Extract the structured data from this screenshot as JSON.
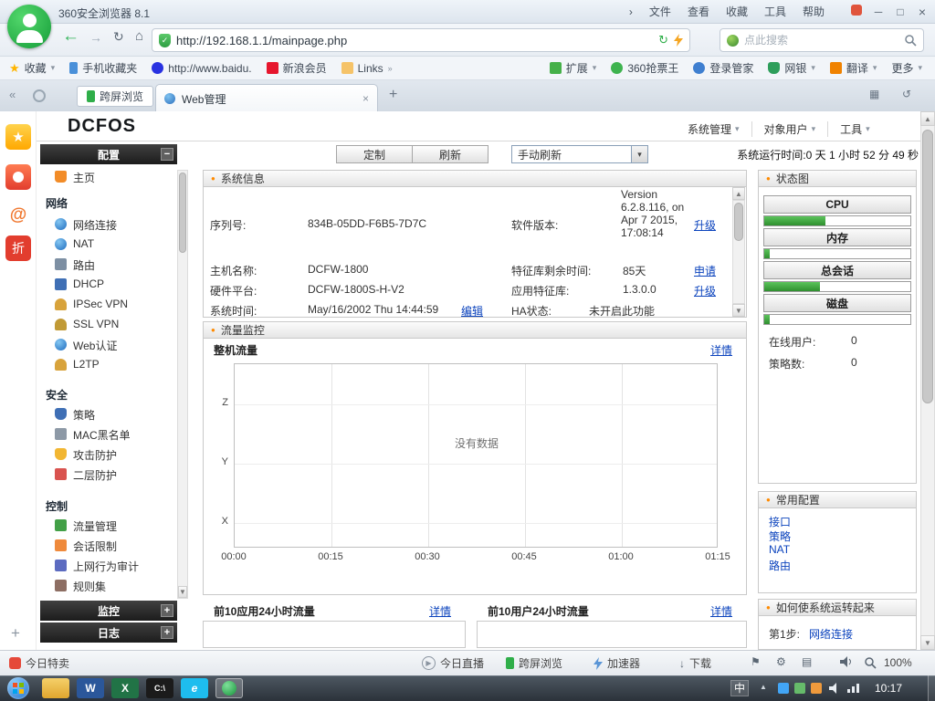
{
  "icons": {
    "back": "←",
    "forward": "→",
    "reload": "↻",
    "home": "⌂",
    "dropdown": "▾",
    "chevron_right": "›",
    "chevron_left": "«",
    "minimize": "─",
    "maximize": "□",
    "close": "×",
    "tab_close": "×",
    "new_tab": "+",
    "plus": "+",
    "collapse": "−",
    "expand": "+",
    "bullet": "●",
    "star": "★",
    "up": "▲",
    "down": "▼",
    "play": "▶",
    "download_arrow": "↓",
    "links_more": "»",
    "restore": "▦",
    "undo": "↺",
    "flag": "⚑",
    "gear": "⚙",
    "page": "▤",
    "check": "✓",
    "word_glyph": "W",
    "excel_glyph": "X",
    "cmd_glyph": "C:\\",
    "ie_glyph": "e"
  },
  "titlebar": {
    "app_title": "360安全浏览器 8.1",
    "menus": [
      "文件",
      "查看",
      "收藏",
      "工具",
      "帮助"
    ]
  },
  "addressbar": {
    "url": "http://192.168.1.1/mainpage.php",
    "search_placeholder": "点此搜索"
  },
  "bookmarks_bar": {
    "favorites": "收藏",
    "items": [
      "手机收藏夹",
      "http://www.baidu.",
      "新浪会员",
      "Links"
    ],
    "tools": [
      "扩展",
      "360抢票王",
      "登录管家",
      "网银",
      "翻译",
      "更多"
    ]
  },
  "tab_bar": {
    "cross_screen": "跨屏浏览",
    "active_tab": "Web管理"
  },
  "side_strip": {
    "at": "@",
    "discount": "折"
  },
  "page": {
    "logo": "DCFOS",
    "top_menus": [
      "系统管理",
      "对象用户",
      "工具"
    ],
    "toolbar": {
      "customize": "定制",
      "refresh": "刷新",
      "refresh_mode": "手动刷新",
      "uptime": "系统运行时间:0 天 1 小时 52 分 49 秒"
    },
    "nav": {
      "config": "配置",
      "home": "主页",
      "monitor": "监控",
      "log": "日志",
      "groups": [
        {
          "label": "网络",
          "items": [
            "网络连接",
            "NAT",
            "路由",
            "DHCP",
            "IPSec VPN",
            "SSL VPN",
            "Web认证",
            "L2TP"
          ]
        },
        {
          "label": "安全",
          "items": [
            "策略",
            "MAC黑名单",
            "攻击防护",
            "二层防护"
          ]
        },
        {
          "label": "控制",
          "items": [
            "流量管理",
            "会话限制",
            "上网行为审计",
            "规则集"
          ]
        }
      ]
    },
    "system_info": {
      "title": "系统信息",
      "serial_label": "序列号:",
      "serial": "834B-05DD-F6B5-7D7C",
      "version_label": "软件版本:",
      "version": "Version 6.2.8.116, on Apr 7 2015, 17:08:14",
      "version_link": "升级",
      "hostname_label": "主机名称:",
      "hostname": "DCFW-1800",
      "signature_label": "特征库剩余时间:",
      "signature": "85天",
      "signature_link": "申请",
      "platform_label": "硬件平台:",
      "platform": "DCFW-1800S-H-V2",
      "app_sig_label": "应用特征库:",
      "app_sig": "1.3.0.0",
      "app_sig_link": "升级",
      "time_label": "系统时间:",
      "time": "May/16/2002 Thu 14:44:59",
      "time_link": "编辑",
      "ha_label": "HA状态:",
      "ha": "未开启此功能"
    },
    "traffic": {
      "title": "流量监控",
      "whole_title": "整机流量",
      "detail": "详情",
      "app_title": "前10应用24小时流量",
      "app_detail": "详情",
      "user_title": "前10用户24小时流量",
      "user_detail": "详情"
    },
    "status": {
      "title": "状态图",
      "metrics": [
        {
          "label": "CPU",
          "percent": 42
        },
        {
          "label": "内存",
          "percent": 4
        },
        {
          "label": "总会话",
          "percent": 38
        },
        {
          "label": "磁盘",
          "percent": 4
        }
      ],
      "online_label": "在线用户:",
      "online": "0",
      "policy_label": "策略数:",
      "policy": "0"
    },
    "common": {
      "title": "常用配置",
      "links": [
        "接口",
        "策略",
        "NAT",
        "路由"
      ]
    },
    "guide": {
      "title": "如何使系统运转起来",
      "step1_label": "第1步:",
      "step1_link": "网络连接"
    }
  },
  "chart_data": {
    "type": "line",
    "title": "整机流量",
    "x_ticks": [
      "00:00",
      "00:15",
      "00:30",
      "00:45",
      "01:00",
      "01:15"
    ],
    "y_ticks": [
      "Z",
      "Y",
      "X"
    ],
    "series": [],
    "empty_message": "没有数据"
  },
  "bottom_bar": {
    "deals": "今日特卖",
    "live": "今日直播",
    "cross_screen": "跨屏浏览",
    "accelerator": "加速器",
    "download": "下载",
    "zoom": "100%"
  },
  "taskbar": {
    "ime": "中",
    "time": "10:17"
  },
  "colors": {
    "accent_green": "#22ac38",
    "link_blue": "#0b43bd",
    "header_orange": "#ff8a00",
    "bar_green": "#3faa3f"
  }
}
